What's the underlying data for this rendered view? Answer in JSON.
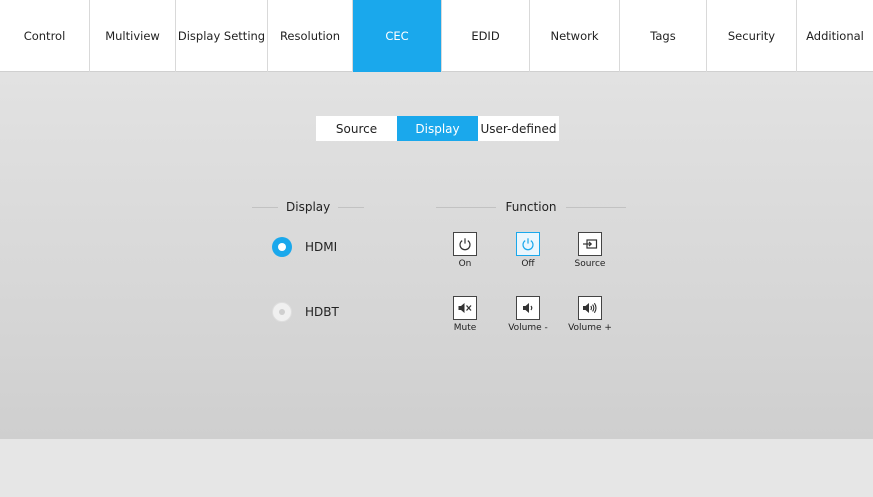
{
  "nav": {
    "tabs": [
      {
        "label": "Control"
      },
      {
        "label": "Multiview"
      },
      {
        "label": "Display Setting"
      },
      {
        "label": "Resolution"
      },
      {
        "label": "CEC",
        "active": true
      },
      {
        "label": "EDID"
      },
      {
        "label": "Network"
      },
      {
        "label": "Tags"
      },
      {
        "label": "Security"
      },
      {
        "label": "Additional"
      }
    ]
  },
  "subtabs": [
    {
      "label": "Source"
    },
    {
      "label": "Display",
      "active": true
    },
    {
      "label": "User-defined"
    }
  ],
  "display_section": {
    "title": "Display",
    "options": [
      {
        "label": "HDMI",
        "selected": true
      },
      {
        "label": "HDBT",
        "selected": false
      }
    ]
  },
  "function_section": {
    "title": "Function",
    "buttons": [
      {
        "label": "On",
        "icon": "power-icon"
      },
      {
        "label": "Off",
        "icon": "power-icon",
        "active": true
      },
      {
        "label": "Source",
        "icon": "source-input-icon"
      },
      {
        "label": "Mute",
        "icon": "mute-icon"
      },
      {
        "label": "Volume -",
        "icon": "volume-down-icon"
      },
      {
        "label": "Volume +",
        "icon": "volume-up-icon"
      }
    ]
  },
  "colors": {
    "accent": "#1aa8ec",
    "nav_bg": "#ffffff",
    "content_bg": "#dcdcdc"
  }
}
